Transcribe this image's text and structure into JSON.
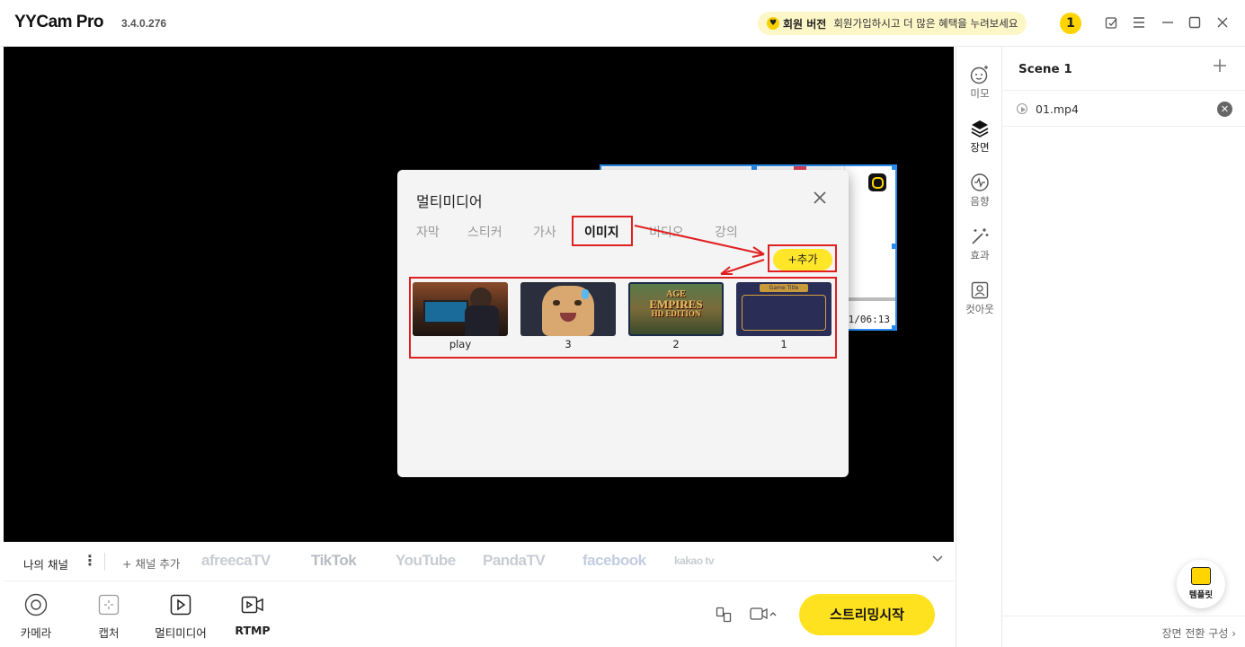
{
  "app": {
    "name": "YYCam Pro",
    "version": "3.4.0.276"
  },
  "member": {
    "label": "회원 버전",
    "promo": "회원가입하시고 더 많은 혜택을 누려보세요",
    "badge": "1"
  },
  "preview": {
    "pip_time": "21/06:13"
  },
  "modal": {
    "title": "멀티미디어",
    "tabs": [
      {
        "label": "자막"
      },
      {
        "label": "스티커"
      },
      {
        "label": "가사"
      },
      {
        "label": "이미지",
        "active": true
      },
      {
        "label": "비디오"
      },
      {
        "label": "강의"
      }
    ],
    "add_label": "+추가",
    "images": [
      {
        "caption": "play"
      },
      {
        "caption": "3"
      },
      {
        "caption": "2"
      },
      {
        "caption": "1"
      }
    ],
    "thumb_text": {
      "aoe_line1": "AGE",
      "aoe_line2": "EMPIRES",
      "aoe_line3": "HD EDITION",
      "frame_banner": "Game Title"
    }
  },
  "channels": {
    "my_channel": "나의 채널",
    "add_channel": "+ 채널 추가",
    "platforms": [
      "afreecaTV",
      "TikTok",
      "YouTube",
      "PandaTV",
      "facebook",
      "kakao tv"
    ]
  },
  "toolbar": {
    "camera": "카메라",
    "capture": "캡처",
    "multimedia": "멀티미디어",
    "rtmp": "RTMP",
    "start": "스트리밍시작"
  },
  "sidenav": [
    {
      "label": "미모",
      "icon": "face-icon"
    },
    {
      "label": "장면",
      "icon": "layers-icon",
      "active": true
    },
    {
      "label": "음향",
      "icon": "audio-icon"
    },
    {
      "label": "효과",
      "icon": "effect-icon"
    },
    {
      "label": "컷아웃",
      "icon": "cutout-icon"
    }
  ],
  "scene": {
    "title": "Scene 1",
    "sources": [
      {
        "name": "01.mp4"
      }
    ],
    "template_label": "템플릿",
    "footer": "장면 전환 구성"
  }
}
